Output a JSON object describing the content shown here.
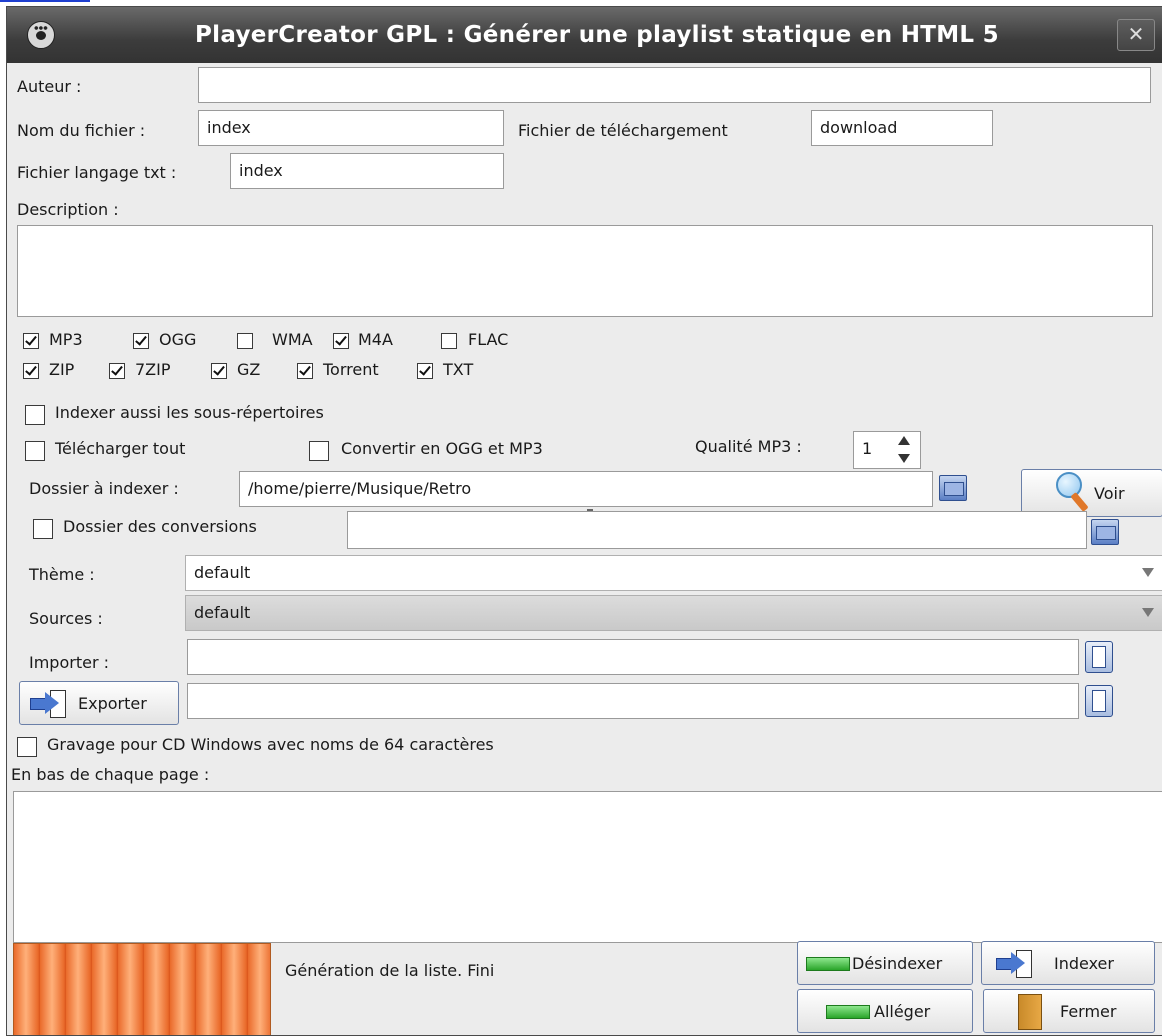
{
  "window": {
    "title": "PlayerCreator GPL  : Générer une playlist statique en HTML 5",
    "close_glyph": "✕"
  },
  "form": {
    "auteur_label": "Auteur :",
    "auteur_value": "",
    "nom_fichier_label": "Nom du fichier :",
    "nom_fichier_value": "index",
    "fichier_telechargement_label": "Fichier de téléchargement",
    "fichier_telechargement_value": "download",
    "fichier_langage_label": "Fichier langage txt :",
    "fichier_langage_value": "index",
    "description_label": "Description :",
    "description_value": ""
  },
  "formats": [
    {
      "label": "MP3",
      "checked": true
    },
    {
      "label": "OGG",
      "checked": true
    },
    {
      "label": "WMA",
      "checked": false
    },
    {
      "label": "M4A",
      "checked": true
    },
    {
      "label": "FLAC",
      "checked": false
    },
    {
      "label": "ZIP",
      "checked": true
    },
    {
      "label": "7ZIP",
      "checked": true
    },
    {
      "label": "GZ",
      "checked": true
    },
    {
      "label": "Torrent",
      "checked": true
    },
    {
      "label": "TXT",
      "checked": true
    }
  ],
  "options": {
    "indexer_sous_rep": {
      "label": "Indexer aussi les sous-répertoires",
      "checked": false
    },
    "telecharger_tout": {
      "label": "Télécharger tout",
      "checked": false
    },
    "convertir": {
      "label": "Convertir en OGG et MP3",
      "checked": false
    },
    "qualite_label": "Qualité MP3 :",
    "qualite_value": "1",
    "dossier_indexer_label": "Dossier à indexer :",
    "dossier_indexer_value": "/home/pierre/Musique/Retro",
    "voir_label": "Voir",
    "dossier_conversions": {
      "label": "Dossier des conversions",
      "checked": false
    },
    "dossier_conversions_value": "",
    "theme_label": "Thème :",
    "theme_value": "default",
    "sources_label": "Sources :",
    "sources_value": "default",
    "importer_label": "Importer :",
    "importer_value": "",
    "exporter_label": "Exporter",
    "exporter_value": "",
    "gravage": {
      "label": "Gravage pour CD Windows avec noms de 64 caractères",
      "checked": false
    },
    "en_bas_label": "En bas de chaque page :",
    "en_bas_value": ""
  },
  "status": {
    "message": "Génération de la liste. Fini"
  },
  "buttons": {
    "desindexer": "Désindexer",
    "indexer": "Indexer",
    "alleger": "Alléger",
    "fermer": "Fermer"
  }
}
